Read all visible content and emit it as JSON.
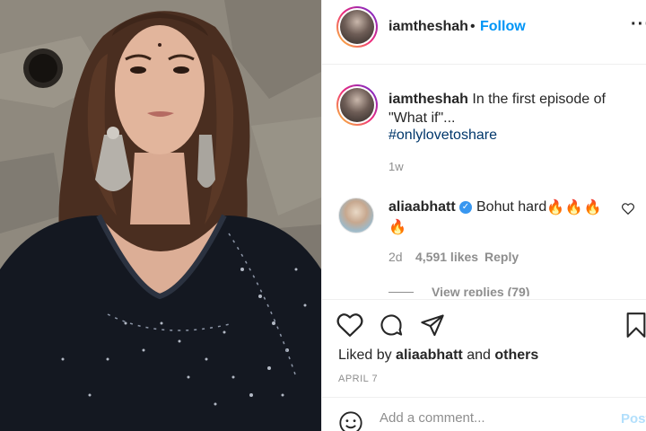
{
  "header": {
    "username": "iamtheshah",
    "separator": "•",
    "follow_label": "Follow",
    "more_icon": "more-options-icon",
    "more_glyph": "···"
  },
  "caption": {
    "username": "iamtheshah",
    "text": "In the first episode of \"What if\"...",
    "hashtag": "#onlylovetoshare",
    "time": "1w"
  },
  "comment": {
    "username": "aliaabhatt",
    "text": "Bohut hard",
    "emojis": "🔥🔥🔥",
    "emojis_line2": "🔥",
    "time": "2d",
    "likes": "4,591 likes",
    "reply_label": "Reply",
    "view_replies": "View replies (79)"
  },
  "actions": {
    "liked_by_prefix": "Liked by",
    "liked_by_user": "aliaabhatt",
    "liked_by_and": "and",
    "liked_by_others": "others",
    "date": "APRIL 7"
  },
  "comment_box": {
    "placeholder": "Add a comment...",
    "post_label": "Post"
  },
  "colors": {
    "link_blue": "#0095f6",
    "hashtag_blue": "#00376b",
    "muted_gray": "#8e8e8e",
    "text": "#262626",
    "verified_blue": "#3897f0"
  }
}
